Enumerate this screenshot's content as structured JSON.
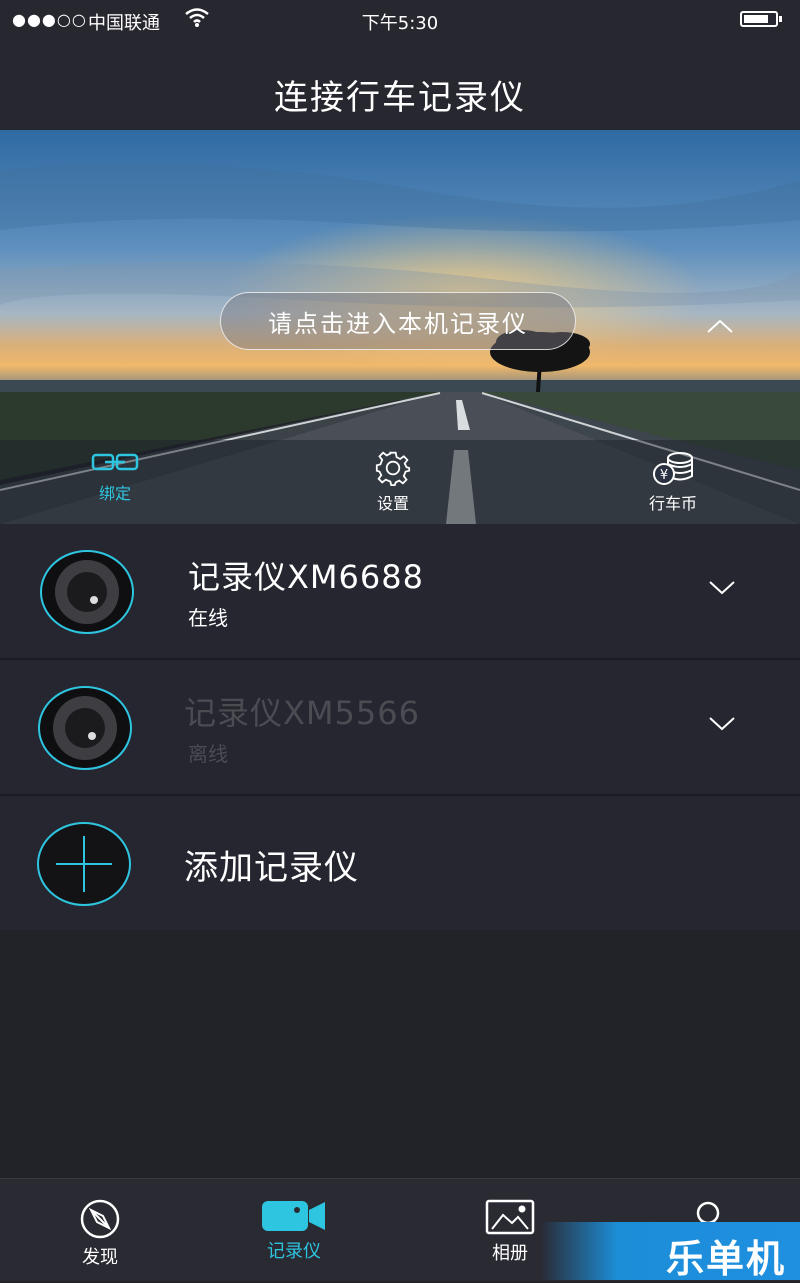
{
  "status_bar": {
    "signal": "●●●○○",
    "carrier": "中国联通",
    "time": "下午5:30"
  },
  "nav": {
    "title": "连接行车记录仪"
  },
  "hero": {
    "enter_button": "请点击进入本机记录仪",
    "tools": [
      {
        "label": "绑定",
        "icon": "link-icon",
        "active": true
      },
      {
        "label": "设置",
        "icon": "gear-icon",
        "active": false
      },
      {
        "label": "行车币",
        "icon": "coins-icon",
        "active": false
      }
    ]
  },
  "devices": [
    {
      "name": "记录仪XM6688",
      "status": "在线",
      "online": true
    },
    {
      "name": "记录仪XM5566",
      "status": "离线",
      "online": false
    }
  ],
  "add_device": {
    "label": "添加记录仪"
  },
  "tabs": [
    {
      "label": "发现",
      "icon": "compass-icon",
      "active": false
    },
    {
      "label": "记录仪",
      "icon": "camera-icon",
      "active": true
    },
    {
      "label": "相册",
      "icon": "photo-icon",
      "active": false
    },
    {
      "label": "",
      "icon": "user-icon",
      "active": false
    }
  ],
  "watermark": {
    "text": "乐单机"
  },
  "colors": {
    "accent": "#2ec5e0",
    "background": "#222229",
    "row": "#262630"
  }
}
